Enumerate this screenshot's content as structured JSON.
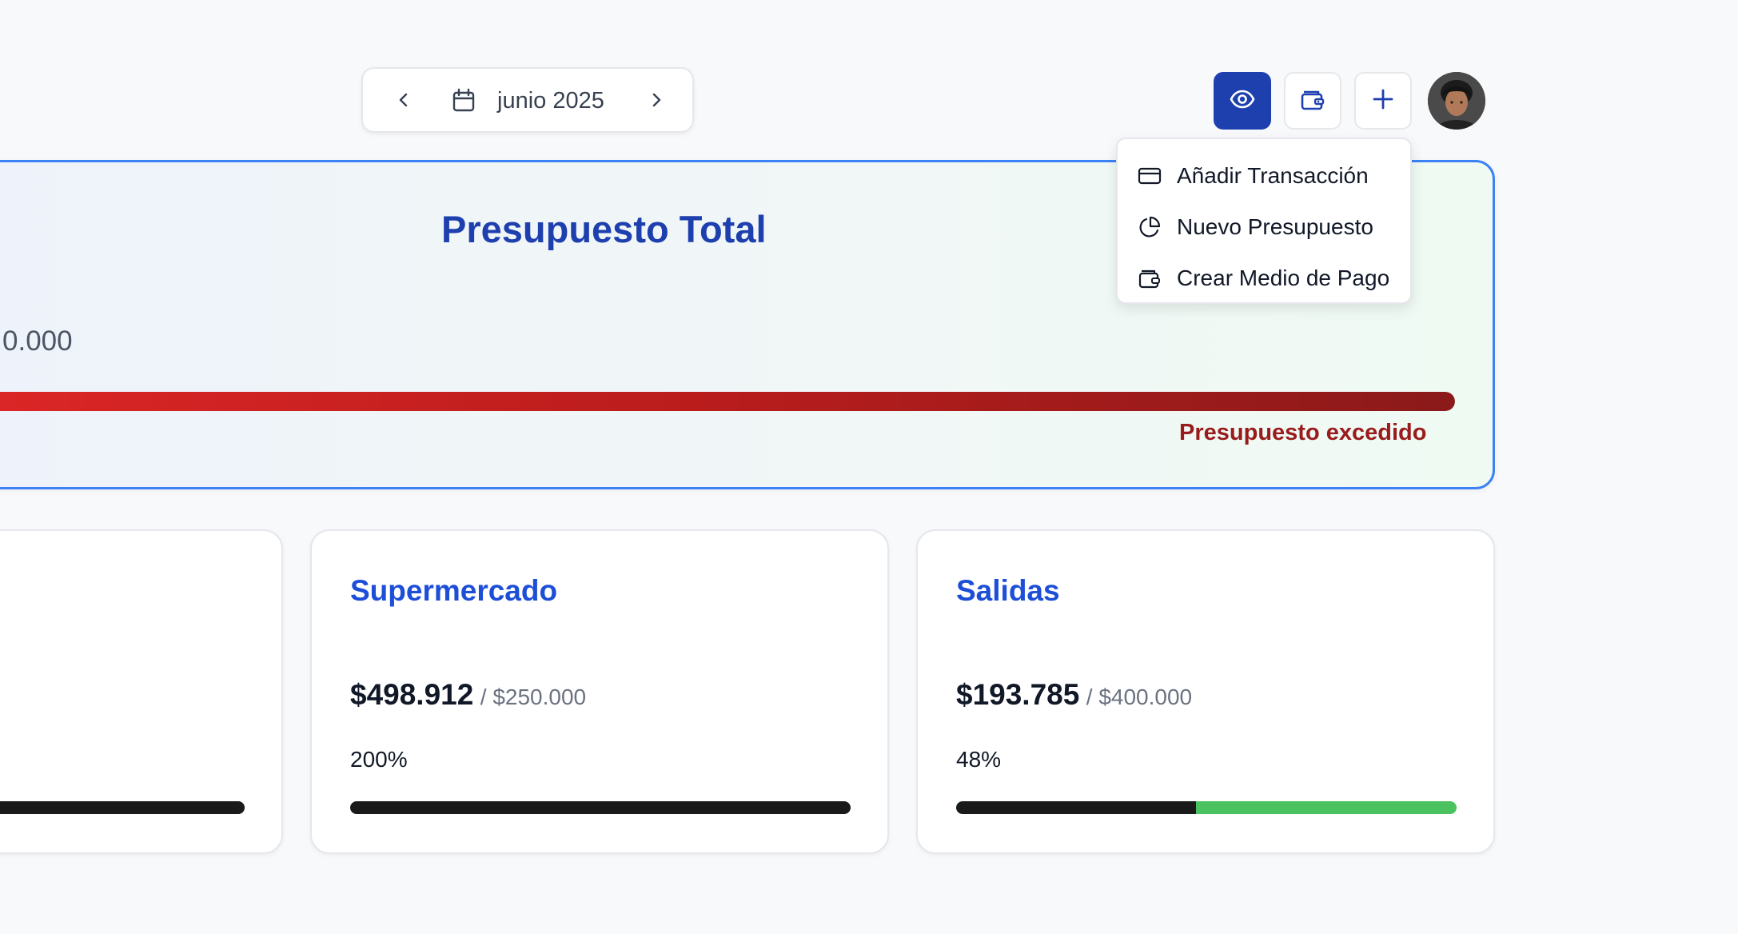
{
  "header": {
    "month_label": "junio 2025",
    "prev_icon": "chevron-left-icon",
    "next_icon": "chevron-right-icon",
    "calendar_icon": "calendar-icon",
    "actions": [
      {
        "name": "eye-icon",
        "active": true
      },
      {
        "name": "wallet-icon",
        "active": false
      },
      {
        "name": "plus-icon",
        "active": false
      }
    ],
    "accent_color": "#1e40af"
  },
  "dropdown": {
    "items": [
      {
        "label": "Añadir Transacción",
        "icon": "credit-card-icon"
      },
      {
        "label": "Nuevo Presupuesto",
        "icon": "pie-chart-icon"
      },
      {
        "label": "Crear Medio de Pago",
        "icon": "wallet-icon"
      }
    ]
  },
  "total": {
    "title": "Presupuesto Total",
    "amount_visible": "0.000",
    "status": "Presupuesto excedido",
    "progress": 1.0,
    "colors": {
      "bar_start": "#dc2626",
      "bar_end": "#8b1a1a",
      "status": "#991b1b",
      "border": "#3b82f6"
    }
  },
  "categories": [
    {
      "title": "",
      "spent": "",
      "budget": "",
      "percent": "",
      "progress": 1.0
    },
    {
      "title": "Supermercado",
      "spent": "$498.912",
      "budget": "/ $250.000",
      "percent": "200%",
      "progress": 1.0
    },
    {
      "title": "Salidas",
      "spent": "$193.785",
      "budget": "/ $400.000",
      "percent": "48%",
      "progress": 0.48
    }
  ],
  "colors": {
    "category_title": "#1d4ed8",
    "progress_fill": "#1a1a1a",
    "progress_remaining": "#4ac260"
  }
}
